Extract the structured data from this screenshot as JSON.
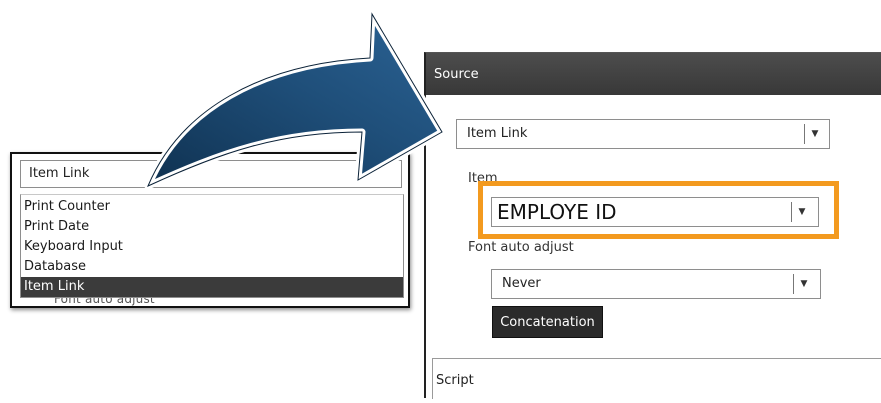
{
  "left_dropdown": {
    "selected_value": "Item Link",
    "options": [
      "Print Counter",
      "Print Date",
      "Keyboard Input",
      "Database",
      "Item Link"
    ],
    "highlighted_index": 4,
    "background_label": "Font auto adjust"
  },
  "right_panel": {
    "header": "Source",
    "source_select_value": "Item Link",
    "item_label": "Item",
    "item_select_value": "EMPLOYE ID",
    "font_label": "Font auto adjust",
    "font_select_value": "Never",
    "concatenation_button": "Concatenation",
    "script_section": "Script"
  },
  "colors": {
    "highlight": "#f39a1f",
    "arrow": "#1f4f7a",
    "header_bg": "#3f3f3f",
    "selected_option_bg": "#3b3b3b"
  },
  "icons": {
    "dropdown_arrow": "chevron-down-icon",
    "curved_arrow": "curved-arrow-icon"
  }
}
